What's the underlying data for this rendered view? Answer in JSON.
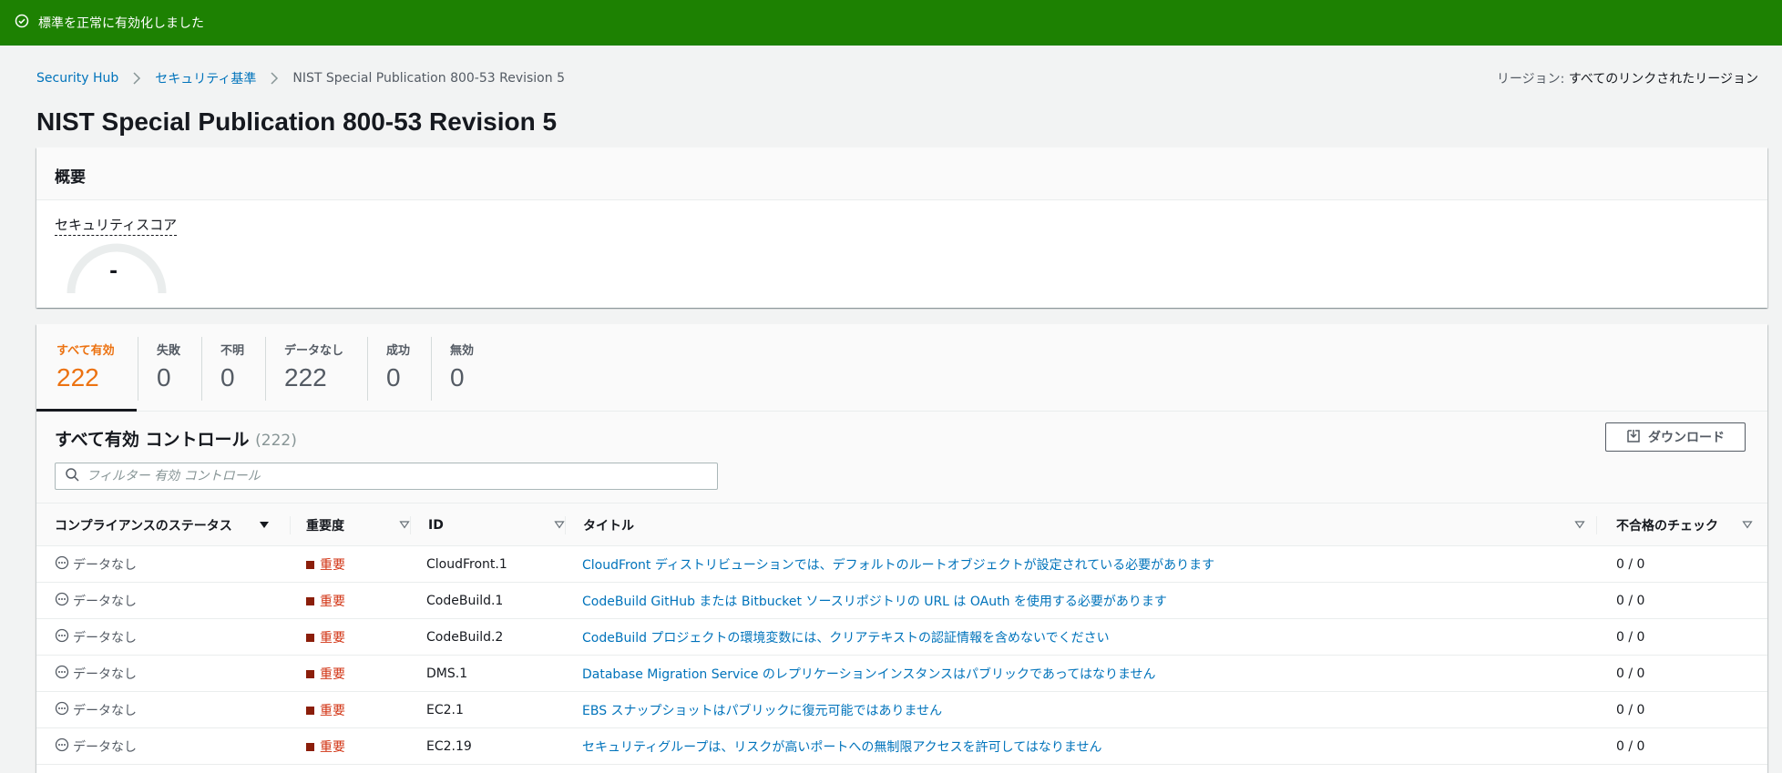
{
  "flash": {
    "message": "標準を正常に有効化しました",
    "icon": "check-circle-icon",
    "color": "#1d8102"
  },
  "breadcrumb": {
    "items": [
      "Security Hub",
      "セキュリティ基準",
      "NIST Special Publication 800-53 Revision 5"
    ]
  },
  "region": {
    "label": "リージョン:",
    "value": "すべてのリンクされたリージョン"
  },
  "page": {
    "title": "NIST Special Publication 800-53 Revision 5"
  },
  "overview": {
    "heading": "概要",
    "score_label": "セキュリティスコア",
    "score_value": "-"
  },
  "tabs": [
    {
      "label": "すべて有効",
      "count": "222"
    },
    {
      "label": "失敗",
      "count": "0"
    },
    {
      "label": "不明",
      "count": "0"
    },
    {
      "label": "データなし",
      "count": "222"
    },
    {
      "label": "成功",
      "count": "0"
    },
    {
      "label": "無効",
      "count": "0"
    }
  ],
  "table": {
    "title": "すべて有効 コントロール",
    "count": "(222)",
    "download_label": "ダウンロード",
    "filter_placeholder": "フィルター 有効 コントロール",
    "columns": [
      "コンプライアンスのステータス",
      "重要度",
      "ID",
      "タイトル",
      "不合格のチェック"
    ],
    "rows": [
      {
        "status": "データなし",
        "severity": "重要",
        "id": "CloudFront.1",
        "title": "CloudFront ディストリビューションでは、デフォルトのルートオブジェクトが設定されている必要があります",
        "failed": "0 / 0"
      },
      {
        "status": "データなし",
        "severity": "重要",
        "id": "CodeBuild.1",
        "title": "CodeBuild GitHub または Bitbucket ソースリポジトリの URL は OAuth を使用する必要があります",
        "failed": "0 / 0"
      },
      {
        "status": "データなし",
        "severity": "重要",
        "id": "CodeBuild.2",
        "title": "CodeBuild プロジェクトの環境変数には、クリアテキストの認証情報を含めないでください",
        "failed": "0 / 0"
      },
      {
        "status": "データなし",
        "severity": "重要",
        "id": "DMS.1",
        "title": "Database Migration Service のレプリケーションインスタンスはパブリックであってはなりません",
        "failed": "0 / 0"
      },
      {
        "status": "データなし",
        "severity": "重要",
        "id": "EC2.1",
        "title": "EBS スナップショットはパブリックに復元可能ではありません",
        "failed": "0 / 0"
      },
      {
        "status": "データなし",
        "severity": "重要",
        "id": "EC2.19",
        "title": "セキュリティグループは、リスクが高いポートへの無制限アクセスを許可してはなりません",
        "failed": "0 / 0"
      }
    ]
  },
  "colors": {
    "accent": "#ec7211",
    "link": "#0073bb",
    "critical": "#d13212"
  }
}
